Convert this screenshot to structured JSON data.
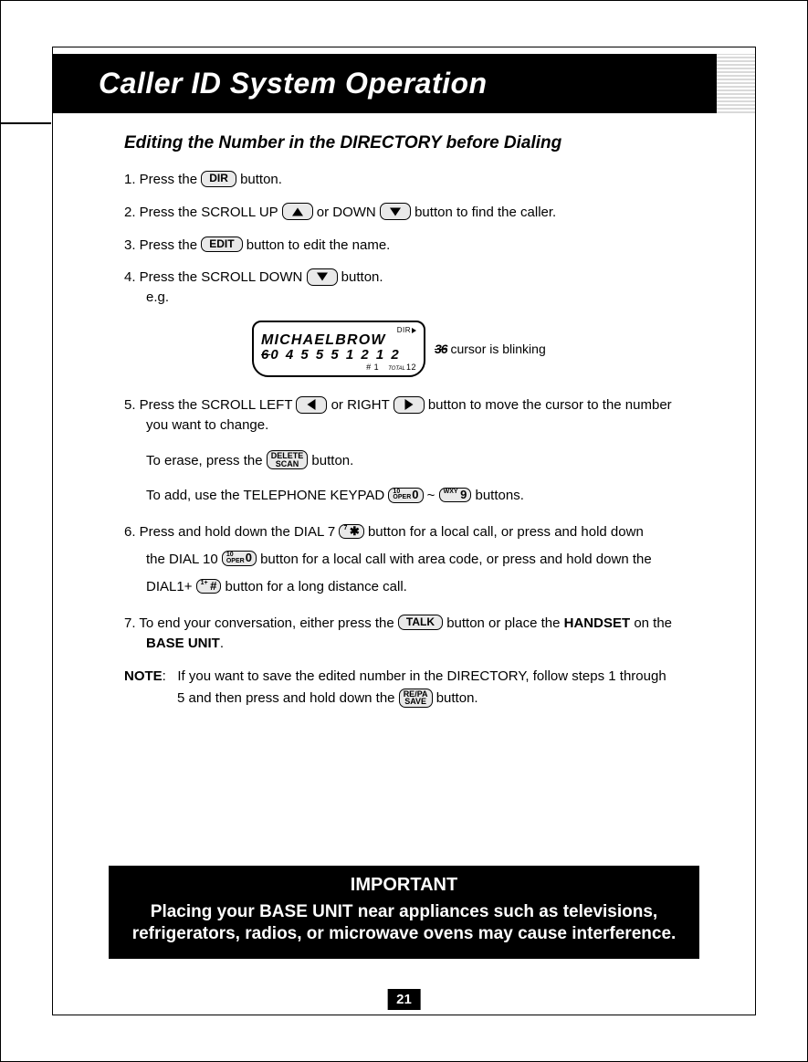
{
  "header": {
    "title": "Caller ID System Operation"
  },
  "section_heading": "Editing the Number in the DIRECTORY before Dialing",
  "steps": {
    "s1_a": "1.  Press the ",
    "s1_b": " button.",
    "s2_a": "2.  Press  the  SCROLL UP ",
    "s2_b": " or DOWN ",
    "s2_c": " button to find the caller.",
    "s3_a": "3.  Press the ",
    "s3_b": " button to edit the name.",
    "s4_a": "4.  Press  the  SCROLL DOWN ",
    "s4_b": " button.",
    "s4_eg": "e.g.",
    "s5_a": "5.  Press  the  SCROLL LEFT ",
    "s5_b": " or RIGHT ",
    "s5_c": " button to move the cursor to the number",
    "s5_d": "you want to change.",
    "s5_erase_a": "To erase, press the ",
    "s5_erase_b": " button.",
    "s5_add_a": "To add, use the TELEPHONE KEYPAD ",
    "s5_add_sep": " ~ ",
    "s5_add_b": " buttons.",
    "s6_a": "6.  Press and hold down the DIAL 7 ",
    "s6_b": " button for a local call, or press and hold down",
    "s6_c": "the DIAL 10 ",
    "s6_d": " button for a local call with area code, or press and hold down the",
    "s6_e": "DIAL1+  ",
    "s6_f": " button for a long distance call.",
    "s7_a": "7.  To end your conversation, either press the ",
    "s7_b": " button or place the ",
    "s7_handset": "HANDSET",
    "s7_c": " on the",
    "s7_base": "BASE UNIT",
    "s7_d": "."
  },
  "note": {
    "label": "NOTE",
    "colon": ":",
    "a": "If you want to save the edited number in the DIRECTORY, follow steps 1 through",
    "b": "5 and then press and hold down the ",
    "c": " button."
  },
  "keys": {
    "dir": "DIR",
    "edit": "EDIT",
    "delete_l1": "DELETE",
    "delete_l2": "SCAN",
    "oper10_l1": "10",
    "oper10_l2": "OPER",
    "oper10_big": "0",
    "wxy9_pre": "WXY",
    "wxy9_big": "9",
    "dial7_pre": "7",
    "dial7_big": "✱",
    "dial1_pre": "1+",
    "dial1_big": "#",
    "talk": "TALK",
    "repa_l1": "RE/PA",
    "repa_l2": "SAVE"
  },
  "lcd": {
    "dir_label": "DIR",
    "row1": "MICHAELBROW",
    "row2_cur": "6",
    "row2_rest": "0 4  5 5 5  1 2 1 2",
    "foot_hash": "#",
    "foot_num1": "1",
    "foot_total_label": "TOTAL",
    "foot_num2": "12",
    "annot_mark": "36",
    "annot_text": " cursor is blinking"
  },
  "important": {
    "heading": "IMPORTANT",
    "body": "Placing your BASE UNIT near appliances such as televisions, refrigerators, radios, or microwave ovens may cause interference."
  },
  "page_number": "21"
}
